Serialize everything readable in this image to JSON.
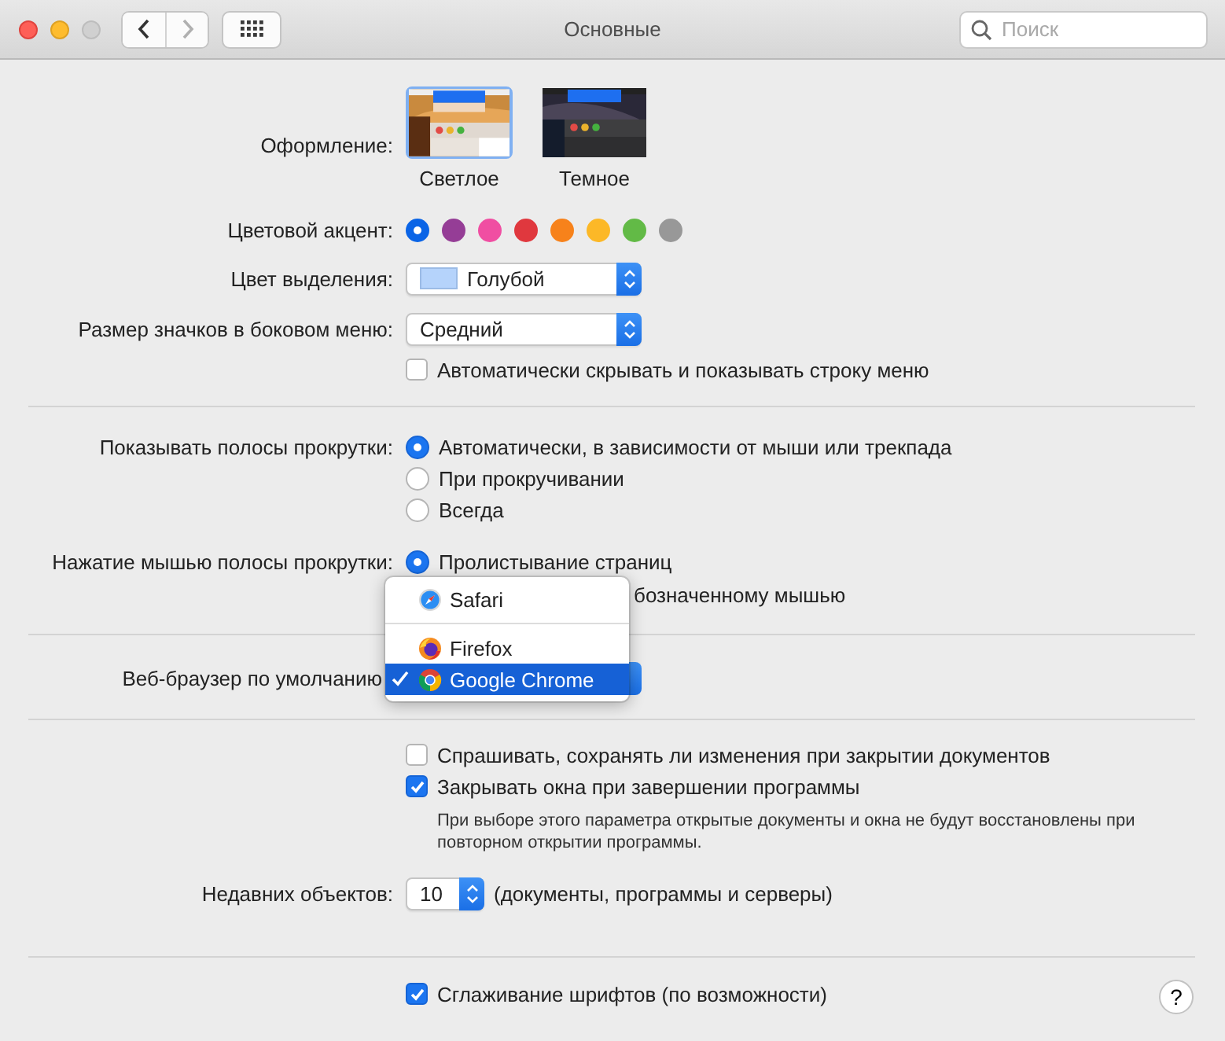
{
  "window": {
    "title": "Основные"
  },
  "toolbar": {
    "back_enabled": true,
    "forward_enabled": false,
    "search": {
      "placeholder": "Поиск"
    }
  },
  "appearance": {
    "label": "Оформление:",
    "options": [
      {
        "label": "Светлое",
        "kind": "light",
        "selected": true
      },
      {
        "label": "Темное",
        "kind": "dark",
        "selected": false
      }
    ]
  },
  "accent": {
    "label": "Цветовой акцент:",
    "colors": [
      {
        "color": "#0a64e6",
        "selected": true
      },
      {
        "color": "#953d96",
        "selected": false
      },
      {
        "color": "#f04ea2",
        "selected": false
      },
      {
        "color": "#e0383e",
        "selected": false
      },
      {
        "color": "#f7821b",
        "selected": false
      },
      {
        "color": "#fcb827",
        "selected": false
      },
      {
        "color": "#62ba46",
        "selected": false
      },
      {
        "color": "#989898",
        "selected": false
      }
    ]
  },
  "highlight": {
    "label": "Цвет выделения:",
    "value": "Голубой",
    "color": "#b5d3fb"
  },
  "sidebar_icon_size": {
    "label": "Размер значков в боковом меню:",
    "value": "Средний"
  },
  "auto_hide_menu_bar": {
    "label": "Автоматически скрывать и показывать строку меню",
    "checked": false
  },
  "show_scroll_bars": {
    "label": "Показывать полосы прокрутки:",
    "options": [
      {
        "label": "Автоматически, в зависимости от мыши или трекпада",
        "selected": true
      },
      {
        "label": "При прокручивании",
        "selected": false
      },
      {
        "label": "Всегда",
        "selected": false
      }
    ]
  },
  "click_scroll_bar": {
    "label": "Нажатие мышью полосы прокрутки:",
    "options": [
      {
        "label": "Пролистывание страниц",
        "selected": true
      }
    ],
    "partial_text": "бозначенному мышью"
  },
  "default_browser": {
    "label": "Веб-браузер по умолчанию",
    "menu": [
      {
        "kind": "safari",
        "label": "Safari",
        "selected": false
      },
      {
        "kind": "separator"
      },
      {
        "kind": "firefox",
        "label": "Firefox",
        "selected": false
      },
      {
        "kind": "chrome",
        "label": "Google Chrome",
        "selected": true
      }
    ]
  },
  "ask_keep_changes": {
    "label": "Спрашивать, сохранять ли изменения при закрытии документов",
    "checked": false
  },
  "close_windows": {
    "label": "Закрывать окна при завершении программы",
    "checked": true,
    "note": "При выборе этого параметра открытые документы и окна не будут восстановлены при повторном открытии программы."
  },
  "recent_items": {
    "label": "Недавних объектов:",
    "value": "10",
    "note": "(документы, программы и серверы)"
  },
  "font_smoothing": {
    "label": "Сглаживание шрифтов (по возможности)",
    "checked": true
  },
  "help": "?"
}
